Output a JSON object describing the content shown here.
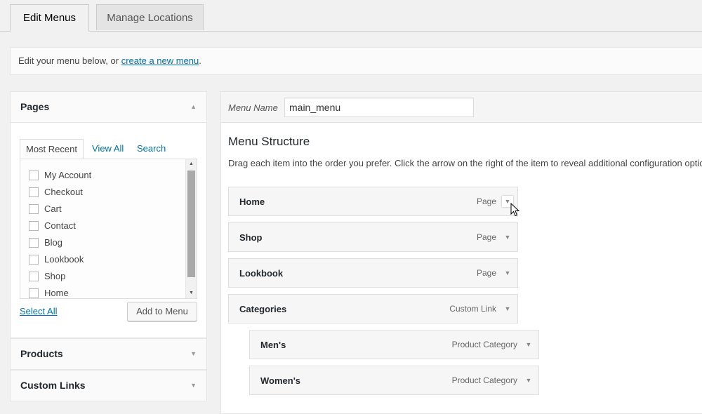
{
  "tabs": {
    "edit_menus": "Edit Menus",
    "manage_locations": "Manage Locations"
  },
  "notice": {
    "text_before": "Edit your menu below, or ",
    "link": "create a new menu",
    "text_after": "."
  },
  "left": {
    "pages": {
      "heading": "Pages",
      "tabs": [
        "Most Recent",
        "View All",
        "Search"
      ],
      "items": [
        "My Account",
        "Checkout",
        "Cart",
        "Contact",
        "Blog",
        "Lookbook",
        "Shop",
        "Home"
      ],
      "select_all": "Select All",
      "add_button": "Add to Menu"
    },
    "products": {
      "heading": "Products"
    },
    "custom_links": {
      "heading": "Custom Links"
    }
  },
  "right": {
    "menu_name_label": "Menu Name",
    "menu_name_value": "main_menu",
    "structure_title": "Menu Structure",
    "instructions": "Drag each item into the order you prefer. Click the arrow on the right of the item to reveal additional configuration options.",
    "items": [
      {
        "title": "Home",
        "type": "Page",
        "depth": 0
      },
      {
        "title": "Shop",
        "type": "Page",
        "depth": 0
      },
      {
        "title": "Lookbook",
        "type": "Page",
        "depth": 0
      },
      {
        "title": "Categories",
        "type": "Custom Link",
        "depth": 0
      },
      {
        "title": "Men's",
        "type": "Product Category",
        "depth": 1
      },
      {
        "title": "Women's",
        "type": "Product Category",
        "depth": 1
      }
    ]
  },
  "icons": {
    "collapse": "triangle-up-icon",
    "expand": "triangle-down-icon"
  },
  "colors": {
    "link": "#0073aa",
    "background": "#f1f1f1"
  }
}
